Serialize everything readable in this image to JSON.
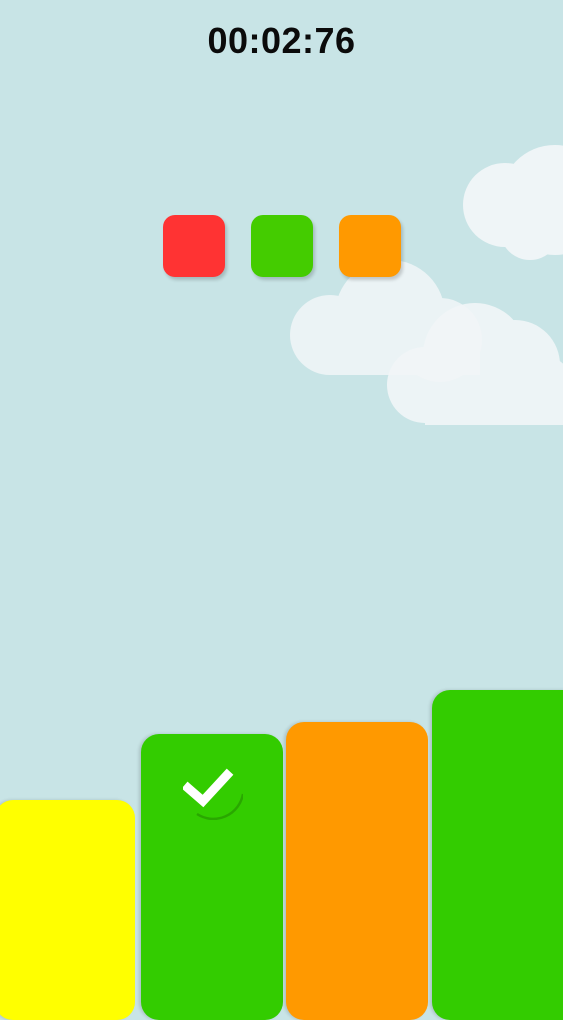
{
  "timer": {
    "text": "00:02:76"
  },
  "targets": [
    {
      "color": "#ff3333"
    },
    {
      "color": "#44cc00"
    },
    {
      "color": "#ff9900"
    }
  ],
  "columns": [
    {
      "color": "#ffff00",
      "checked": false
    },
    {
      "color": "#33cc00",
      "checked": true
    },
    {
      "color": "#ff9900",
      "checked": false
    },
    {
      "color": "#33cc00",
      "checked": false
    }
  ],
  "icons": {
    "check": "check-icon"
  }
}
